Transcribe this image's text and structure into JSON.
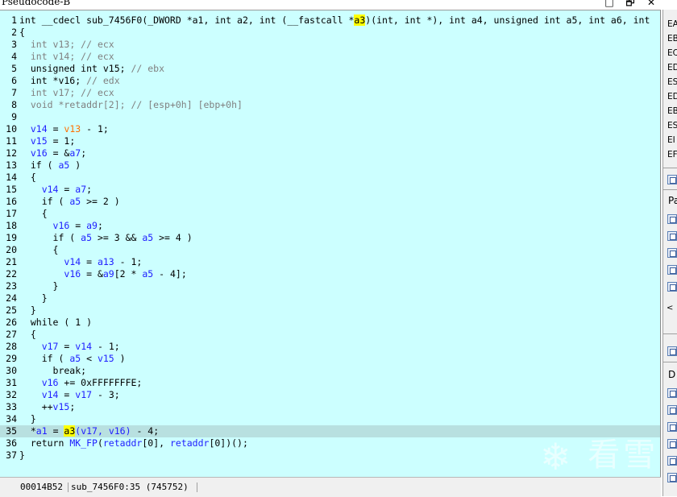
{
  "window": {
    "title": "Pseudocode-B",
    "controls": {
      "pin": "□",
      "restore": "🗗",
      "close": "✕"
    }
  },
  "colors": {
    "editor_bg": "#ccffff",
    "current_line_bg": "#b8e0e0",
    "comment": "#808080",
    "variable": "#2020ff",
    "highlight": "#ffff00",
    "orange": "#ff7000"
  },
  "code": {
    "lines": [
      {
        "n": "1",
        "parts": [
          [
            "k",
            "int __cdecl sub_7456F0(_DWORD *a1, int a2, int (__fastcall *"
          ],
          [
            "y",
            "a3"
          ],
          [
            "k",
            ")(int, int *), int a4, unsigned int a5, int a6, int"
          ]
        ]
      },
      {
        "n": "2",
        "parts": [
          [
            "k",
            "{"
          ]
        ]
      },
      {
        "n": "3",
        "parts": [
          [
            "k",
            "  "
          ],
          [
            "g",
            "int v13; // ecx"
          ]
        ]
      },
      {
        "n": "4",
        "parts": [
          [
            "k",
            "  "
          ],
          [
            "g",
            "int v14; // ecx"
          ]
        ]
      },
      {
        "n": "5",
        "parts": [
          [
            "k",
            "  unsigned int v15; "
          ],
          [
            "g",
            "// ebx"
          ]
        ]
      },
      {
        "n": "6",
        "parts": [
          [
            "k",
            "  int *v16; "
          ],
          [
            "g",
            "// edx"
          ]
        ]
      },
      {
        "n": "7",
        "parts": [
          [
            "k",
            "  "
          ],
          [
            "g",
            "int v17; // ecx"
          ]
        ]
      },
      {
        "n": "8",
        "parts": [
          [
            "k",
            "  "
          ],
          [
            "g",
            "void *retaddr[2]; // [esp+0h] [ebp+0h]"
          ]
        ]
      },
      {
        "n": "9",
        "parts": []
      },
      {
        "n": "10",
        "parts": [
          [
            "k",
            "  "
          ],
          [
            "b",
            "v14"
          ],
          [
            "k",
            " = "
          ],
          [
            "o",
            "v13"
          ],
          [
            "k",
            " - 1;"
          ]
        ]
      },
      {
        "n": "11",
        "parts": [
          [
            "k",
            "  "
          ],
          [
            "b",
            "v15"
          ],
          [
            "k",
            " = 1;"
          ]
        ]
      },
      {
        "n": "12",
        "parts": [
          [
            "k",
            "  "
          ],
          [
            "b",
            "v16"
          ],
          [
            "k",
            " = &"
          ],
          [
            "b",
            "a7"
          ],
          [
            "k",
            ";"
          ]
        ]
      },
      {
        "n": "13",
        "parts": [
          [
            "k",
            "  if ( "
          ],
          [
            "b",
            "a5"
          ],
          [
            "k",
            " )"
          ]
        ]
      },
      {
        "n": "14",
        "parts": [
          [
            "k",
            "  {"
          ]
        ]
      },
      {
        "n": "15",
        "parts": [
          [
            "k",
            "    "
          ],
          [
            "b",
            "v14"
          ],
          [
            "k",
            " = "
          ],
          [
            "b",
            "a7"
          ],
          [
            "k",
            ";"
          ]
        ]
      },
      {
        "n": "16",
        "parts": [
          [
            "k",
            "    if ( "
          ],
          [
            "b",
            "a5"
          ],
          [
            "k",
            " >= 2 )"
          ]
        ]
      },
      {
        "n": "17",
        "parts": [
          [
            "k",
            "    {"
          ]
        ]
      },
      {
        "n": "18",
        "parts": [
          [
            "k",
            "      "
          ],
          [
            "b",
            "v16"
          ],
          [
            "k",
            " = "
          ],
          [
            "b",
            "a9"
          ],
          [
            "k",
            ";"
          ]
        ]
      },
      {
        "n": "19",
        "parts": [
          [
            "k",
            "      if ( "
          ],
          [
            "b",
            "a5"
          ],
          [
            "k",
            " >= 3 && "
          ],
          [
            "b",
            "a5"
          ],
          [
            "k",
            " >= 4 )"
          ]
        ]
      },
      {
        "n": "20",
        "parts": [
          [
            "k",
            "      {"
          ]
        ]
      },
      {
        "n": "21",
        "parts": [
          [
            "k",
            "        "
          ],
          [
            "b",
            "v14"
          ],
          [
            "k",
            " = "
          ],
          [
            "b",
            "a13"
          ],
          [
            "k",
            " - 1;"
          ]
        ]
      },
      {
        "n": "22",
        "parts": [
          [
            "k",
            "        "
          ],
          [
            "b",
            "v16"
          ],
          [
            "k",
            " = &"
          ],
          [
            "b",
            "a9"
          ],
          [
            "k",
            "[2 * "
          ],
          [
            "b",
            "a5"
          ],
          [
            "k",
            " - 4];"
          ]
        ]
      },
      {
        "n": "23",
        "parts": [
          [
            "k",
            "      }"
          ]
        ]
      },
      {
        "n": "24",
        "parts": [
          [
            "k",
            "    }"
          ]
        ]
      },
      {
        "n": "25",
        "parts": [
          [
            "k",
            "  }"
          ]
        ]
      },
      {
        "n": "26",
        "parts": [
          [
            "k",
            "  while ( 1 )"
          ]
        ]
      },
      {
        "n": "27",
        "parts": [
          [
            "k",
            "  {"
          ]
        ]
      },
      {
        "n": "28",
        "parts": [
          [
            "k",
            "    "
          ],
          [
            "b",
            "v17"
          ],
          [
            "k",
            " = "
          ],
          [
            "b",
            "v14"
          ],
          [
            "k",
            " - 1;"
          ]
        ]
      },
      {
        "n": "29",
        "parts": [
          [
            "k",
            "    if ( "
          ],
          [
            "b",
            "a5"
          ],
          [
            "k",
            " < "
          ],
          [
            "b",
            "v15"
          ],
          [
            "k",
            " )"
          ]
        ]
      },
      {
        "n": "30",
        "parts": [
          [
            "k",
            "      break;"
          ]
        ]
      },
      {
        "n": "31",
        "parts": [
          [
            "k",
            "    "
          ],
          [
            "b",
            "v16"
          ],
          [
            "k",
            " += 0xFFFFFFFE;"
          ]
        ]
      },
      {
        "n": "32",
        "parts": [
          [
            "k",
            "    "
          ],
          [
            "b",
            "v14"
          ],
          [
            "k",
            " = "
          ],
          [
            "b",
            "v17"
          ],
          [
            "k",
            " - 3;"
          ]
        ]
      },
      {
        "n": "33",
        "parts": [
          [
            "k",
            "    ++"
          ],
          [
            "b",
            "v15"
          ],
          [
            "k",
            ";"
          ]
        ]
      },
      {
        "n": "34",
        "parts": [
          [
            "k",
            "  }"
          ]
        ]
      },
      {
        "n": "35",
        "parts": [
          [
            "k",
            "  *"
          ],
          [
            "b",
            "a1"
          ],
          [
            "k",
            " = "
          ],
          [
            "y",
            "a3"
          ],
          [
            "b",
            "(v17, v16)"
          ],
          [
            "k",
            " - 4;"
          ]
        ],
        "current": true
      },
      {
        "n": "36",
        "parts": [
          [
            "k",
            "  return "
          ],
          [
            "b",
            "MK_FP"
          ],
          [
            "k",
            "("
          ],
          [
            "b",
            "retaddr"
          ],
          [
            "k",
            "[0], "
          ],
          [
            "b",
            "retaddr"
          ],
          [
            "k",
            "[0])();"
          ]
        ]
      },
      {
        "n": "37",
        "parts": [
          [
            "k",
            "}"
          ]
        ]
      }
    ]
  },
  "status": {
    "offset": "00014B52",
    "location": "sub_7456F0:35 (745752)"
  },
  "right_panel": {
    "registers": [
      "EA",
      "EB",
      "EC",
      "ED",
      "ES",
      "ED",
      "EB",
      "ES",
      "EI",
      "EF"
    ],
    "labels": [
      "Pa",
      "D"
    ],
    "arrow": "<"
  },
  "watermark": {
    "glyph": "❄",
    "text": "看雪"
  }
}
